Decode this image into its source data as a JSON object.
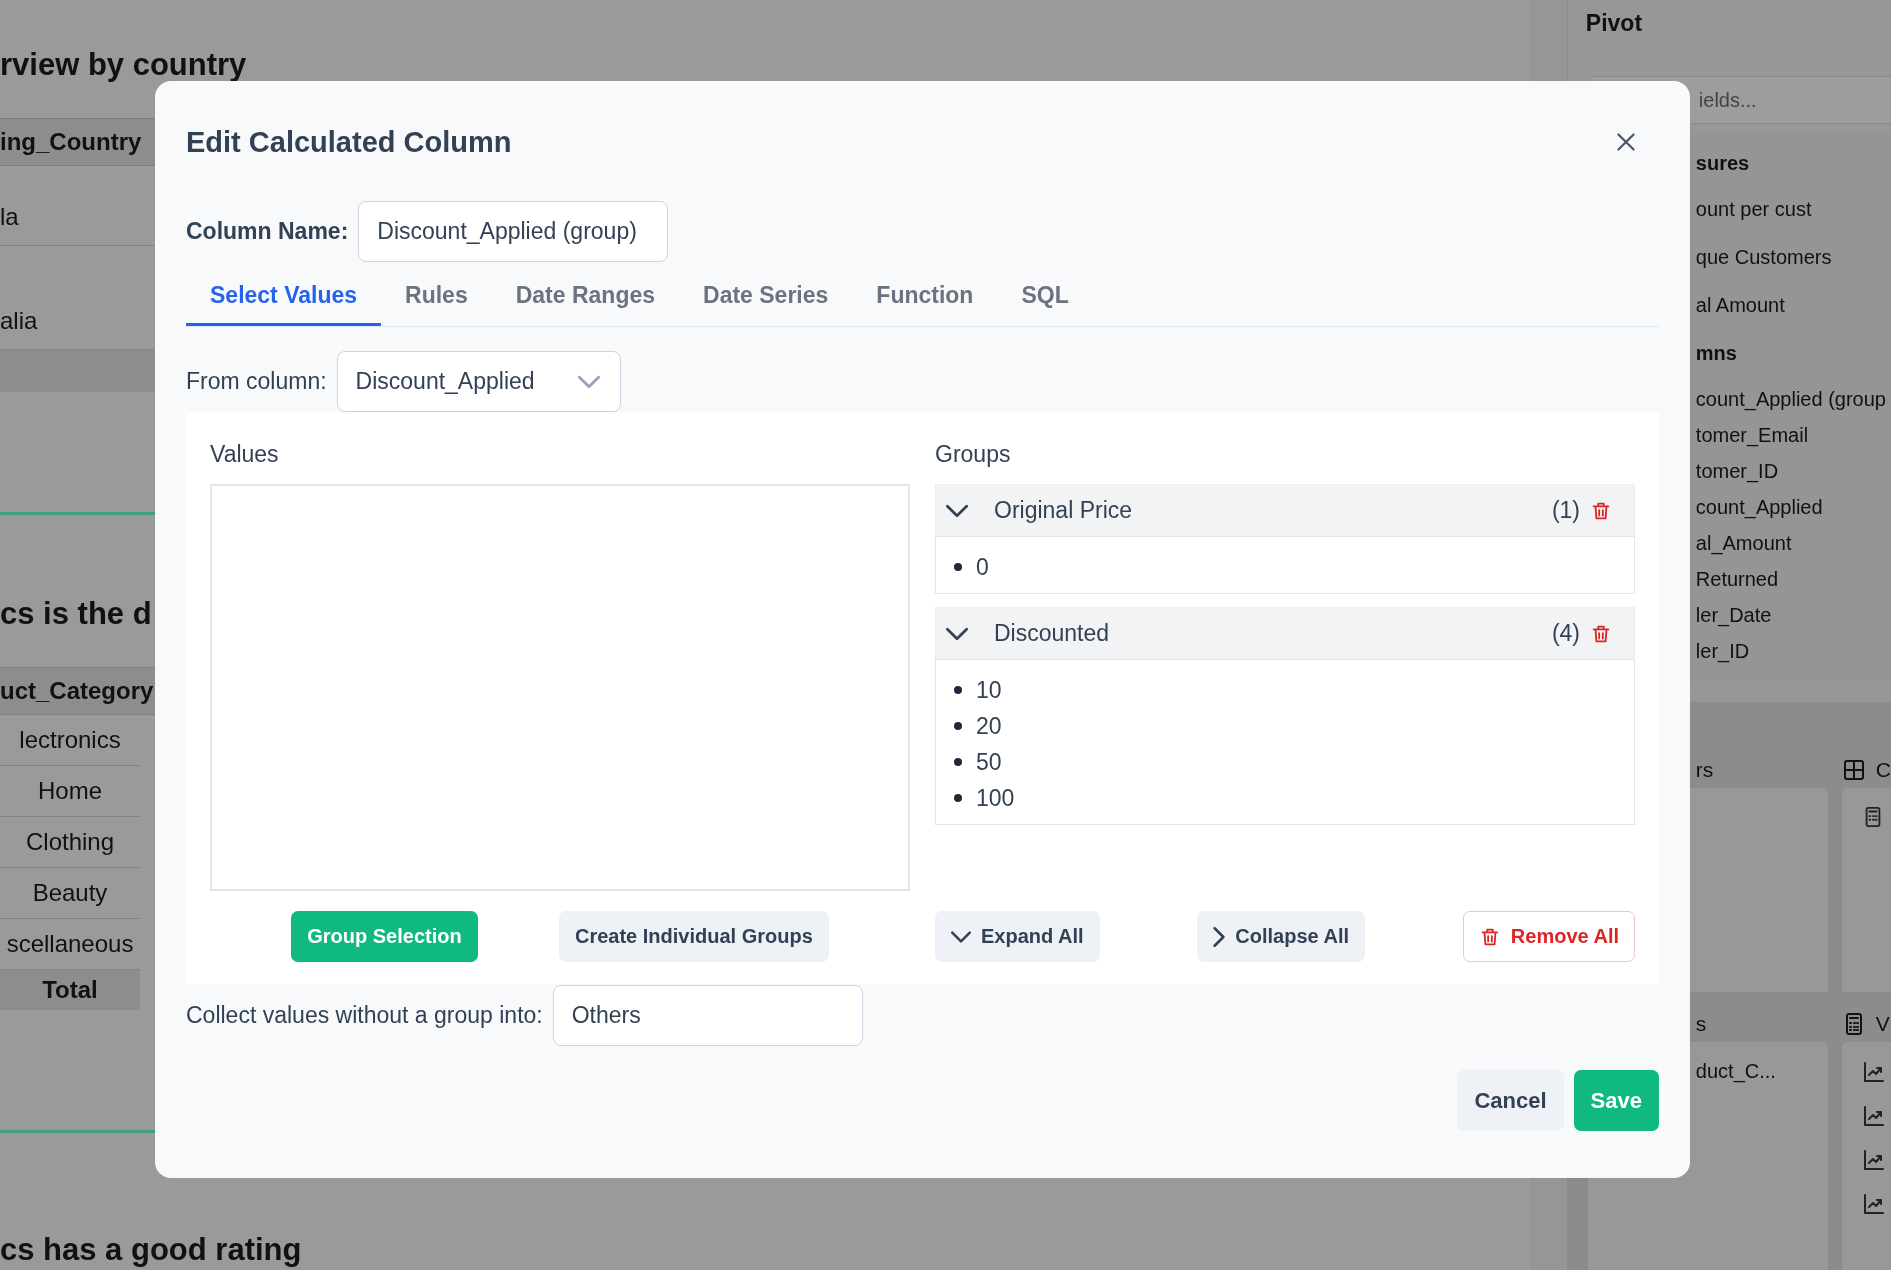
{
  "page": {
    "sections": [
      {
        "heading": "rview by country",
        "table": {
          "header": "ing_Country",
          "rows": [
            "la",
            "alia"
          ]
        }
      },
      {
        "heading": "cs is the d",
        "table": {
          "header": "uct_Category",
          "rows": [
            "lectronics",
            "Home",
            "Clothing",
            "Beauty",
            "scellaneous"
          ],
          "total": "Total"
        }
      },
      {
        "heading": "cs has a good rating"
      }
    ]
  },
  "sidebar": {
    "title": "Pivot",
    "search_placeholder": "ields...",
    "measures_heading": "sures",
    "measures": [
      "ount per cust",
      "que Customers",
      "al Amount"
    ],
    "columns_heading": "mns",
    "columns": [
      "count_Applied (group",
      "tomer_Email",
      "tomer_ID",
      "count_Applied",
      "al_Amount",
      "Returned",
      "ler_Date",
      "ler_ID"
    ],
    "zones": [
      {
        "title": "rs",
        "kind": "plain"
      },
      {
        "title": "C",
        "kind": "grid"
      },
      {
        "title": "s",
        "kind": "plain",
        "items": [
          "duct_C..."
        ]
      },
      {
        "title": "V",
        "kind": "values"
      }
    ]
  },
  "dialog": {
    "title": "Edit Calculated Column",
    "column_name_label": "Column Name:",
    "column_name_value": "Discount_Applied (group)",
    "tabs": [
      {
        "label": "Select Values",
        "selected": true
      },
      {
        "label": "Rules",
        "selected": false
      },
      {
        "label": "Date Ranges",
        "selected": false
      },
      {
        "label": "Date Series",
        "selected": false
      },
      {
        "label": "Function",
        "selected": false
      },
      {
        "label": "SQL",
        "selected": false
      }
    ],
    "from_column_label": "From column:",
    "from_column_value": "Discount_Applied",
    "values_label": "Values",
    "groups_label": "Groups",
    "groups": [
      {
        "name": "Original Price",
        "count": "(1)",
        "expanded": true,
        "items": [
          "0"
        ]
      },
      {
        "name": "Discounted",
        "count": "(4)",
        "expanded": true,
        "items": [
          "10",
          "20",
          "50",
          "100"
        ]
      }
    ],
    "value_buttons": [
      {
        "label": "Group Selection",
        "kind": "primary"
      },
      {
        "label": "Create Individual Groups",
        "kind": "secondary"
      }
    ],
    "group_buttons": [
      {
        "label": "Expand All",
        "kind": "expand"
      },
      {
        "label": "Collapse All",
        "kind": "collapse"
      },
      {
        "label": "Remove All",
        "kind": "danger"
      }
    ],
    "collect_label": "Collect values without a group into:",
    "collect_value": "Others",
    "footer_buttons": [
      {
        "label": "Cancel",
        "kind": "secondary"
      },
      {
        "label": "Save",
        "kind": "primary"
      }
    ]
  }
}
